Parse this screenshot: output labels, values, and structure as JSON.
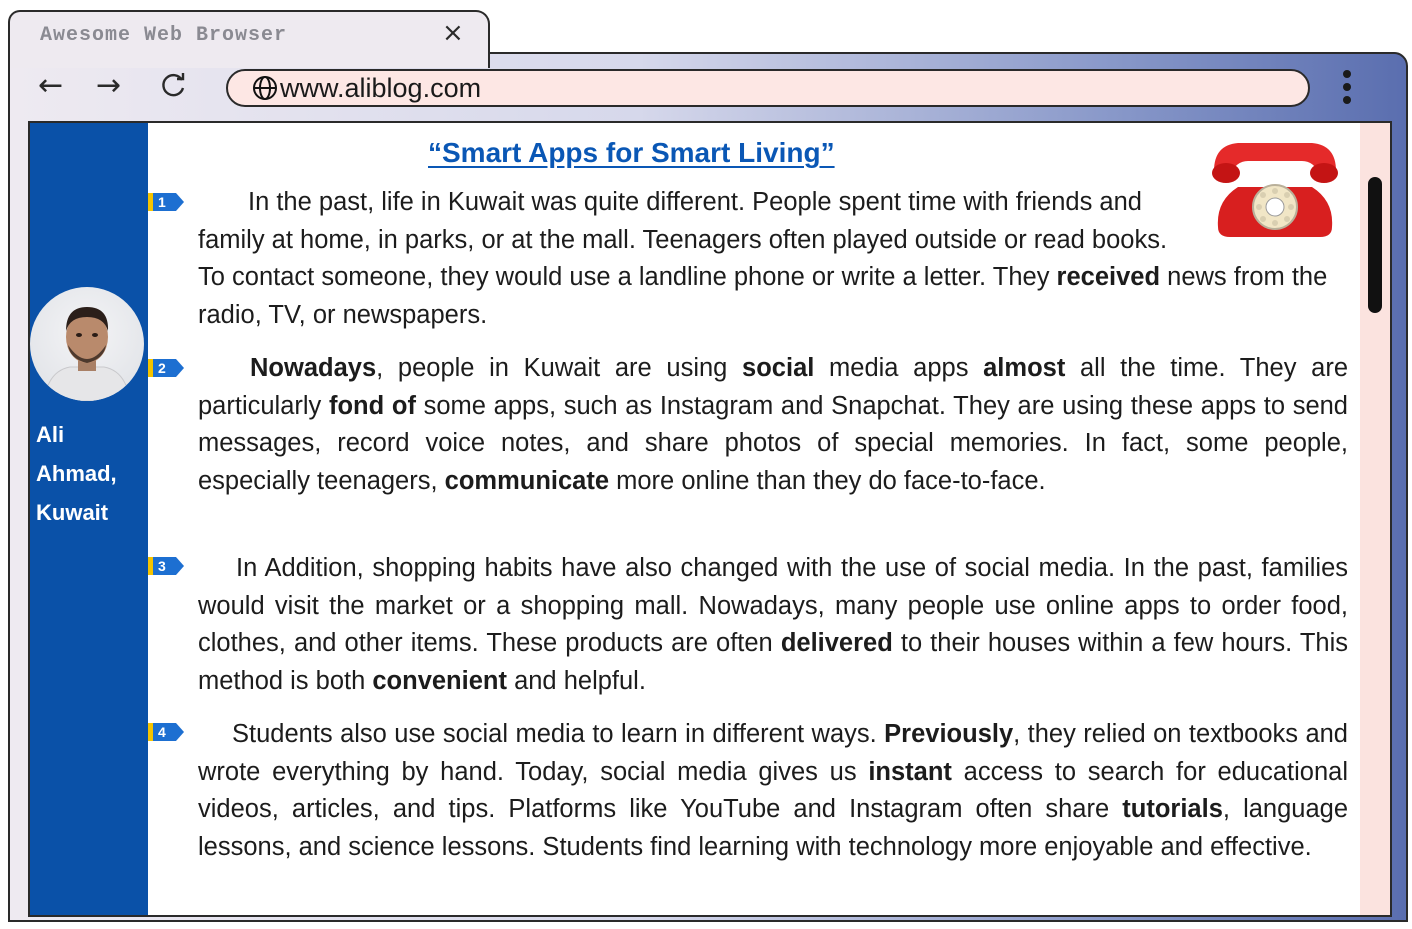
{
  "browser": {
    "tab_title": "Awesome Web Browser",
    "tab_close": "×",
    "url": "www.aliblog.com",
    "nav_back": "←",
    "nav_forward": "→",
    "nav_reload": "↻"
  },
  "sidebar": {
    "author_line1": "Ali",
    "author_line2": "Ahmad,",
    "author_line3": "Kuwait"
  },
  "article": {
    "title": "“Smart Apps for Smart Living”",
    "paragraphs": [
      {
        "number": "1"
      },
      {
        "number": "2"
      },
      {
        "number": "3"
      },
      {
        "number": "4"
      }
    ]
  },
  "texts": {
    "p1_a": "In the past, life in Kuwait was quite different. People spent time with friends and family at home, in parks, or at the mall. Teenagers often played outside or read books. To contact someone, they would use a landline phone or write a letter. They ",
    "p1_b": "received",
    "p1_c": " news from the radio, TV, or newspapers.",
    "p2_a": "Nowadays",
    "p2_b": ", people in Kuwait are using ",
    "p2_c": "social",
    "p2_d": " media apps ",
    "p2_e": "almost",
    "p2_f": " all the time. They are particularly ",
    "p2_g": "fond of",
    "p2_h": " some apps, such as Instagram and Snapchat. They are using these apps to send messages, record voice notes, and share photos of special memories. In fact, some people, especially teenagers, ",
    "p2_i": "communicate",
    "p2_j": " more online than they do face-to-face.",
    "p3_a": "In Addition, shopping habits have also changed with the use of social media. In the past, families would visit the market or a shopping mall. Nowadays, many people use online apps to order food, clothes, and other items. These products are often ",
    "p3_b": "delivered",
    "p3_c": " to their houses within a few hours. This method is both ",
    "p3_d": "convenient",
    "p3_e": " and helpful.",
    "p4_a": "Students also use social media to learn in different ways. ",
    "p4_b": "Previously",
    "p4_c": ", they relied on textbooks and wrote everything by hand. Today, social media gives us ",
    "p4_d": "instant",
    "p4_e": " access to search for educational videos, articles, and tips. Platforms like YouTube and Instagram often share ",
    "p4_f": "tutorials",
    "p4_g": ", language lessons, and science lessons. Students find learning with technology more enjoyable and effective."
  },
  "colors": {
    "sidebar": "#0a51a8",
    "title": "#0a57b5",
    "marker_blue": "#1d6fd1",
    "marker_yellow": "#f5c400",
    "url_bar": "#fde7e4"
  },
  "icons": {
    "globe": "globe-icon",
    "phone": "rotary-phone-image",
    "menu": "kebab-menu-icon"
  }
}
